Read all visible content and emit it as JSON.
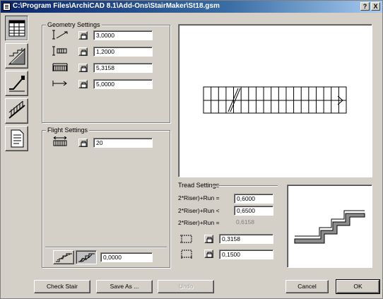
{
  "window": {
    "title": "C:\\Program Files\\ArchiCAD 8.1\\Add-Ons\\StairMaker\\St18.gsm"
  },
  "titlebar_buttons": {
    "help": "?",
    "close": "X"
  },
  "tabs": [
    {
      "name": "geometry-tab",
      "icon": "grid-icon"
    },
    {
      "name": "structure-tab",
      "icon": "stair-structure-icon"
    },
    {
      "name": "floor-tab",
      "icon": "floor-stair-icon"
    },
    {
      "name": "railing-tab",
      "icon": "railing-icon"
    },
    {
      "name": "listing-tab",
      "icon": "document-icon"
    }
  ],
  "geometry_settings": {
    "label": "Geometry Settings",
    "rows": [
      {
        "icon": "height-icon",
        "value": "3,0000"
      },
      {
        "icon": "width-icon",
        "value": "1,2000"
      },
      {
        "icon": "length-icon",
        "value": "5,3158"
      },
      {
        "icon": "arrow-length-icon",
        "value": "5,0000"
      }
    ]
  },
  "flight_settings": {
    "label": "Flight Settings",
    "rows": [
      {
        "icon": "steps-count-icon",
        "value": "20"
      }
    ]
  },
  "bottom_toggle": {
    "value": "0,0000"
  },
  "tread_settings": {
    "label": "Tread Settings",
    "rows": [
      {
        "label": "2*Riser)+Run =",
        "value": "0,6000"
      },
      {
        "label": "2*Riser)+Run <",
        "value": "0,6500"
      },
      {
        "label": "2*Riser)+Run =",
        "value": "0,6158"
      }
    ],
    "riser_value": "0,3158",
    "tread_value": "0,1500"
  },
  "buttons": {
    "check_stair": "Check Stair",
    "save_as": "Save As ...",
    "undo": "Undo",
    "cancel": "Cancel",
    "ok": "OK"
  }
}
